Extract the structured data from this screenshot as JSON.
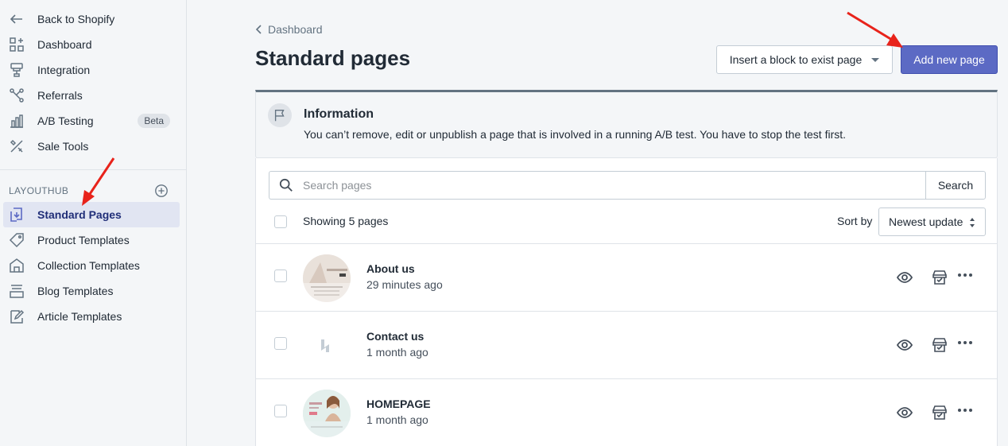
{
  "sidebar": {
    "top_items": [
      {
        "label": "Back to Shopify",
        "icon": "arrow-left-icon"
      },
      {
        "label": "Dashboard",
        "icon": "dashboard-icon"
      },
      {
        "label": "Integration",
        "icon": "integration-icon"
      },
      {
        "label": "Referrals",
        "icon": "referrals-icon"
      },
      {
        "label": "A/B Testing",
        "icon": "chart-icon",
        "badge": "Beta"
      },
      {
        "label": "Sale Tools",
        "icon": "tools-icon"
      }
    ],
    "section_title": "LAYOUTHUB",
    "layout_items": [
      {
        "label": "Standard Pages",
        "icon": "standard-pages-icon",
        "active": true
      },
      {
        "label": "Product Templates",
        "icon": "tag-icon"
      },
      {
        "label": "Collection Templates",
        "icon": "collection-icon"
      },
      {
        "label": "Blog Templates",
        "icon": "blog-icon"
      },
      {
        "label": "Article Templates",
        "icon": "article-icon"
      }
    ]
  },
  "header": {
    "breadcrumb": "Dashboard",
    "title": "Standard pages",
    "insert_button": "Insert a block to exist page",
    "add_button": "Add new page"
  },
  "banner": {
    "title": "Information",
    "text": "You can’t remove, edit or unpublish a page that is involved in a running A/B test. You have to stop the test first."
  },
  "list": {
    "search_placeholder": "Search pages",
    "search_button": "Search",
    "showing": "Showing 5 pages",
    "sort_label": "Sort by",
    "sort_value": "Newest update",
    "rows": [
      {
        "title": "About us",
        "updated": "29 minutes ago"
      },
      {
        "title": "Contact us",
        "updated": "1 month ago"
      },
      {
        "title": "HOMEPAGE",
        "updated": "1 month ago"
      }
    ]
  },
  "colors": {
    "primary": "#5c6ac4",
    "active_bg": "#e1e5f2",
    "annotation_arrow": "#e8231b"
  }
}
